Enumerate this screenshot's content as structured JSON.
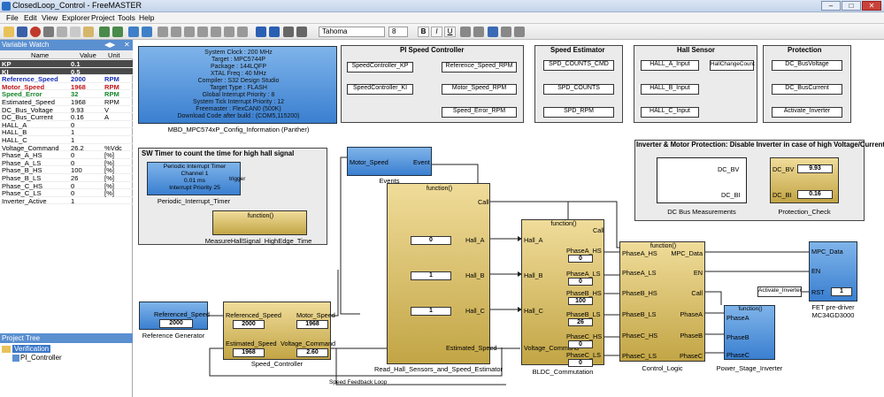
{
  "window": {
    "title": "ClosedLoop_Control - FreeMASTER",
    "min": "–",
    "max": "□",
    "close": "✕"
  },
  "menu": [
    "File",
    "Edit",
    "View",
    "Explorer",
    "Project",
    "Tools",
    "Help"
  ],
  "toolbar": {
    "font": "Tahoma",
    "size": "8",
    "bold": "B",
    "italic": "I",
    "underline": "U"
  },
  "watch": {
    "title": "Variable Watch",
    "cols": [
      "Name",
      "Value",
      "Unit"
    ],
    "rows": [
      {
        "name": "KP",
        "value": "0.1",
        "unit": "",
        "style": "dark"
      },
      {
        "name": "KI",
        "value": "0.5",
        "unit": "",
        "style": "dark"
      },
      {
        "name": "Reference_Speed",
        "value": "2000",
        "unit": "RPM",
        "style": "blue"
      },
      {
        "name": "Motor_Speed",
        "value": "1968",
        "unit": "RPM",
        "style": "red"
      },
      {
        "name": "Speed_Error",
        "value": "32",
        "unit": "RPM",
        "style": "green"
      },
      {
        "name": "Estimated_Speed",
        "value": "1968",
        "unit": "RPM",
        "style": ""
      },
      {
        "name": "DC_Bus_Voltage",
        "value": "9.93",
        "unit": "V",
        "style": ""
      },
      {
        "name": "DC_Bus_Current",
        "value": "0.16",
        "unit": "A",
        "style": ""
      },
      {
        "name": "HALL_A",
        "value": "0",
        "unit": "",
        "style": ""
      },
      {
        "name": "HALL_B",
        "value": "1",
        "unit": "",
        "style": ""
      },
      {
        "name": "HALL_C",
        "value": "1",
        "unit": "",
        "style": ""
      },
      {
        "name": "Voltage_Command",
        "value": "26.2",
        "unit": "%Vdc",
        "style": ""
      },
      {
        "name": "Phase_A_HS",
        "value": "0",
        "unit": "[%]",
        "style": ""
      },
      {
        "name": "Phase_A_LS",
        "value": "0",
        "unit": "[%]",
        "style": ""
      },
      {
        "name": "Phase_B_HS",
        "value": "100",
        "unit": "[%]",
        "style": ""
      },
      {
        "name": "Phase_B_LS",
        "value": "26",
        "unit": "[%]",
        "style": ""
      },
      {
        "name": "Phase_C_HS",
        "value": "0",
        "unit": "[%]",
        "style": ""
      },
      {
        "name": "Phase_C_LS",
        "value": "0",
        "unit": "[%]",
        "style": ""
      },
      {
        "name": "Inverter_Active",
        "value": "1",
        "unit": "",
        "style": ""
      }
    ]
  },
  "tree": {
    "title": "Project Tree",
    "root": "Verification",
    "child": "PI_Controller"
  },
  "diagram": {
    "config": {
      "lines": [
        "System Clock : 200 MHz",
        "Target : MPC5744P",
        "Package : 144LQFP",
        "XTAL Freq : 40 MHz",
        "Compiler : S32 Design Studio",
        "Target Type : FLASH",
        "Global Interrupt Priority : 8",
        "System Tick Interrupt Priority : 12",
        "Freemaster : FlexCAN0 (500K)",
        "Download Code after build : (COM5,115200)"
      ],
      "caption": "MBD_MPC574xP_Config_Information (Panther)"
    },
    "pi": {
      "title": "PI Speed Controller",
      "items": [
        "SpeedController_KP",
        "SpeedController_KI",
        "Reference_Speed_RPM",
        "Motor_Speed_RPM",
        "Speed_Error_RPM"
      ]
    },
    "est": {
      "title": "Speed Estimator",
      "items": [
        "SPD_COUNTS_CMD",
        "SPD_COUNTS",
        "SPD_RPM"
      ]
    },
    "hall": {
      "title": "Hall Sensor",
      "items": [
        "HALL_A_Input",
        "HALL_B_Input",
        "HALL_C_Input",
        "HallChangeCount"
      ]
    },
    "prot": {
      "title": "Protection",
      "items": [
        "DC_BusVoltage",
        "DC_BusCurrent",
        "Activate_Inverter"
      ]
    },
    "sw": {
      "title": "SW Timer to count the time for high hall signal",
      "timer": [
        "Periodic Interrupt Timer",
        "Channel 1",
        "0.01 ms",
        "Interrupt Priority 25"
      ],
      "trigger": "trigger",
      "timer_caption": "Periodic_Interrupt_Timer",
      "fn": "function()",
      "fn_caption": "MeasureHallSignal_HighEdge_Time"
    },
    "inv": {
      "title": "Inverter & Motor Protection: Disable Inverter in case of high Voltage/Current",
      "dcbv": "DC_BV",
      "dcbi": "DC_BI",
      "meas_caption": "DC Bus Measurements",
      "v": "9.93",
      "i": "0.16",
      "check_caption": "Protection_Check"
    },
    "events": {
      "in": "Motor_Speed",
      "out": "Event",
      "caption": "Events"
    },
    "hallblk": {
      "fn": "function()",
      "call": "Call",
      "ports": [
        "Hall_A",
        "Hall_B",
        "Hall_C"
      ],
      "vals": [
        "0",
        "1",
        "1"
      ],
      "out": "Estimated_Speed",
      "caption": "Read_Hall_Sensors_and_Speed_Estimator"
    },
    "bldc": {
      "fn": "function()",
      "ports_in": [
        "Hall_A",
        "Hall_B",
        "Hall_C",
        "Voltage_Command"
      ],
      "ports_out": [
        "PhaseA_HS",
        "PhaseA_LS",
        "PhaseB_HS",
        "PhaseB_LS",
        "PhaseC_HS",
        "PhaseC_LS"
      ],
      "vals": [
        "0",
        "0",
        "100",
        "26",
        "0",
        "0"
      ],
      "caption": "BLDC_Commutation"
    },
    "logic": {
      "fn": "function()",
      "call": "Call",
      "ports_in": [
        "PhaseA_HS",
        "PhaseA_LS",
        "PhaseB_HS",
        "PhaseB_LS",
        "PhaseC_HS",
        "PhaseC_LS"
      ],
      "ports_out": [
        "MPC_Data",
        "EN",
        "Call",
        "PhaseA",
        "PhaseB",
        "PhaseC"
      ],
      "caption": "Control_Logic"
    },
    "inverter": {
      "fn": "function()",
      "ports": [
        "PhaseA",
        "PhaseB",
        "PhaseC"
      ],
      "caption": "Power_Stage_Inverter"
    },
    "fet": {
      "ports": [
        "MPC_Data",
        "EN",
        "RST"
      ],
      "rst_val": "1",
      "caption1": "FET pre-driver",
      "caption2": "MC34GD3000",
      "activate": "Activate_Inverter"
    },
    "refgen": {
      "label": "Referenced_Speed",
      "val": "2000",
      "caption": "Reference Generator"
    },
    "ctrl": {
      "in1": "Referenced_Speed",
      "in2": "Estimated_Speed",
      "out1": "Motor_Speed",
      "out2": "Voltage_Command",
      "v1": "2000",
      "v2": "1968",
      "v3": "1968",
      "v4": "2.60",
      "caption": "Speed_Controller"
    },
    "loop": "Speed Feedback Loop"
  }
}
